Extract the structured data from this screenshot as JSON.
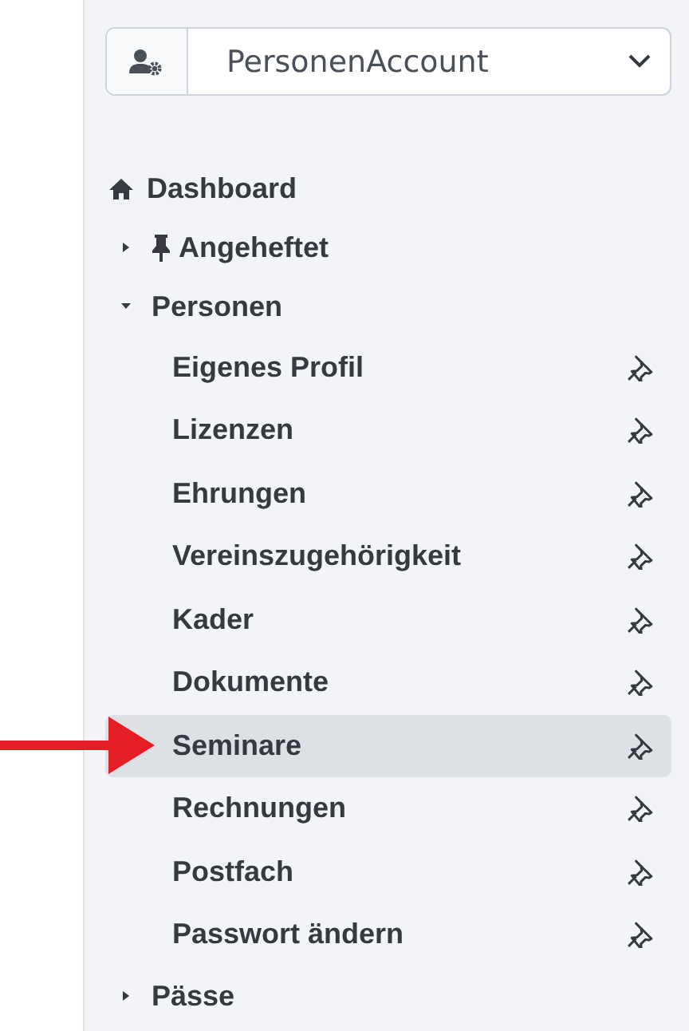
{
  "account_select": {
    "value": "PersonenAccount"
  },
  "nav": [
    {
      "kind": "link",
      "label": "Dashboard"
    },
    {
      "kind": "group",
      "label": "Angeheftet",
      "expanded": false,
      "pinned": true
    },
    {
      "kind": "group",
      "label": "Personen",
      "expanded": true,
      "pinned": false,
      "children": [
        {
          "label": "Eigenes Profil",
          "selected": false
        },
        {
          "label": "Lizenzen",
          "selected": false
        },
        {
          "label": "Ehrungen",
          "selected": false
        },
        {
          "label": "Vereinszugehörigkeit",
          "selected": false
        },
        {
          "label": "Kader",
          "selected": false
        },
        {
          "label": "Dokumente",
          "selected": false
        },
        {
          "label": "Seminare",
          "selected": true
        },
        {
          "label": "Rechnungen",
          "selected": false
        },
        {
          "label": "Postfach",
          "selected": false
        },
        {
          "label": "Passwort ändern",
          "selected": false
        }
      ]
    },
    {
      "kind": "group",
      "label": "Pässe",
      "expanded": false,
      "pinned": false
    }
  ]
}
